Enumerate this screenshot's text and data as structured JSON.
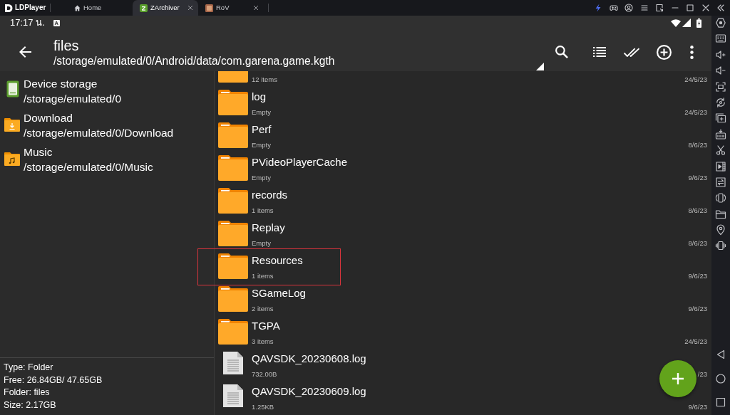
{
  "emulator": {
    "app_name": "LDPlayer",
    "tabs": [
      {
        "label": "Home",
        "kind": "home",
        "selected": false,
        "closable": false
      },
      {
        "label": "ZArchiver",
        "kind": "app",
        "selected": true,
        "closable": true
      },
      {
        "label": "RoV",
        "kind": "game",
        "selected": false,
        "closable": true
      }
    ]
  },
  "status_bar": {
    "time": "17:17 น.",
    "notification": "A"
  },
  "app_bar": {
    "title": "files",
    "path": "/storage/emulated/0/Android/data/com.garena.game.kgth"
  },
  "places": [
    {
      "kind": "storage",
      "name": "Device storage",
      "path": "/storage/emulated/0"
    },
    {
      "kind": "download",
      "name": "Download",
      "path": "/storage/emulated/0/Download"
    },
    {
      "kind": "music",
      "name": "Music",
      "path": "/storage/emulated/0/Music"
    }
  ],
  "info": [
    "Type: Folder",
    "Free: 26.84GB/ 47.65GB",
    "Folder: files",
    "Size: 2.17GB"
  ],
  "files": [
    {
      "kind": "folder",
      "details": "12 items",
      "date": "24/5/23",
      "highlighted": false
    },
    {
      "kind": "folder",
      "name": "log",
      "details": "Empty",
      "date": "24/5/23",
      "highlighted": false
    },
    {
      "kind": "folder",
      "name": "Perf",
      "details": "Empty",
      "date": "8/6/23",
      "highlighted": false
    },
    {
      "kind": "folder",
      "name": "PVideoPlayerCache",
      "details": "Empty",
      "date": "9/6/23",
      "highlighted": false
    },
    {
      "kind": "folder",
      "name": "records",
      "details": "1 items",
      "date": "8/6/23",
      "highlighted": false
    },
    {
      "kind": "folder",
      "name": "Replay",
      "details": "Empty",
      "date": "8/6/23",
      "highlighted": false
    },
    {
      "kind": "folder",
      "name": "Resources",
      "details": "1 items",
      "date": "9/6/23",
      "highlighted": true
    },
    {
      "kind": "folder",
      "name": "SGameLog",
      "details": "2 items",
      "date": "9/6/23",
      "highlighted": false
    },
    {
      "kind": "folder",
      "name": "TGPA",
      "details": "3 items",
      "date": "24/5/23",
      "highlighted": false
    },
    {
      "kind": "file",
      "name": "QAVSDK_20230608.log",
      "details": "732.00B",
      "date": "/23",
      "highlighted": false
    },
    {
      "kind": "file",
      "name": "QAVSDK_20230609.log",
      "details": "1.25KB",
      "date": "9/6/23",
      "highlighted": false
    }
  ]
}
